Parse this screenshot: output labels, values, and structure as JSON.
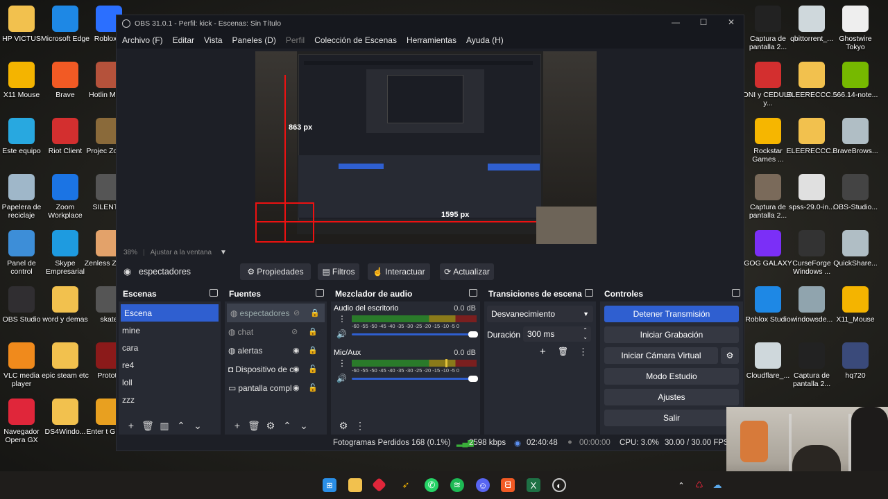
{
  "desktop_left": [
    {
      "label": "HP VICTUS",
      "icon": "folder-icon",
      "color": "#f2c14e"
    },
    {
      "label": "Microsoft Edge",
      "icon": "edge-icon",
      "color": "#1e88e5"
    },
    {
      "label": "Roblox P",
      "icon": "roblox-icon",
      "color": "#2b6fff"
    },
    {
      "label": "X11 Mouse",
      "icon": "x11-mouse-icon",
      "color": "#f4b400"
    },
    {
      "label": "Brave",
      "icon": "brave-icon",
      "color": "#f25a24"
    },
    {
      "label": "Hotlin Miami",
      "icon": "hotline-miami-icon",
      "color": "#b5523b"
    },
    {
      "label": "Este equipo",
      "icon": "computer-icon",
      "color": "#28a8e0"
    },
    {
      "label": "Riot Client",
      "icon": "riot-icon",
      "color": "#d32f2f"
    },
    {
      "label": "Projec Zombo",
      "icon": "project-zomboid-icon",
      "color": "#8a6a3a"
    },
    {
      "label": "Papelera de reciclaje",
      "icon": "recycle-bin-icon",
      "color": "#9fb7c9"
    },
    {
      "label": "Zoom Workplace",
      "icon": "zoom-icon",
      "color": "#1b74e4"
    },
    {
      "label": "SILENT H",
      "icon": "silent-hill-icon",
      "color": "#555"
    },
    {
      "label": "Panel de control",
      "icon": "control-panel-icon",
      "color": "#3d8ed8"
    },
    {
      "label": "Skype Empresarial",
      "icon": "skype-icon",
      "color": "#1e9be0"
    },
    {
      "label": "Zenless Z Zero",
      "icon": "zenless-icon",
      "color": "#e3a26a"
    },
    {
      "label": "OBS Studio",
      "icon": "obs-icon",
      "color": "#302e31"
    },
    {
      "label": "word y demas",
      "icon": "folder-icon",
      "color": "#f2c14e"
    },
    {
      "label": "skate",
      "icon": "skate-icon",
      "color": "#555"
    },
    {
      "label": "VLC media player",
      "icon": "vlc-icon",
      "color": "#f08a1c"
    },
    {
      "label": "epic steam etc",
      "icon": "folder-icon",
      "color": "#f2c14e"
    },
    {
      "label": "Prototy",
      "icon": "prototype-icon",
      "color": "#8b1a1a"
    },
    {
      "label": "Navegador Opera GX",
      "icon": "opera-gx-icon",
      "color": "#e0263a"
    },
    {
      "label": "DS4Windo...",
      "icon": "folder-icon",
      "color": "#f2c14e"
    },
    {
      "label": "Enter t Gunge",
      "icon": "gungeon-icon",
      "color": "#e8a020"
    }
  ],
  "desktop_right": [
    {
      "label": "Captura de pantalla 2...",
      "icon": "screenshot-icon",
      "color": "#222"
    },
    {
      "label": "qbittorrent_...",
      "icon": "qbittorrent-icon",
      "color": "#cfd8dc"
    },
    {
      "label": "Ghostwire Tokyo",
      "icon": "file-icon",
      "color": "#eeeeee"
    },
    {
      "label": "DNI y CEDULA y...",
      "icon": "pdf-icon",
      "color": "#d32f2f"
    },
    {
      "label": "ELEERECCC...",
      "icon": "zip-folder-icon",
      "color": "#f2c14e"
    },
    {
      "label": "566.14-note...",
      "icon": "nvidia-icon",
      "color": "#76b900"
    },
    {
      "label": "Rockstar Games ...",
      "icon": "rockstar-icon",
      "color": "#f6b600"
    },
    {
      "label": "ELEERECCC...",
      "icon": "folder-icon",
      "color": "#f2c14e"
    },
    {
      "label": "BraveBrows...",
      "icon": "installer-icon",
      "color": "#b0bec5"
    },
    {
      "label": "Captura de pantalla 2...",
      "icon": "screenshot-icon",
      "color": "#7a6a5a"
    },
    {
      "label": "spss-29.0-in...",
      "icon": "download-icon",
      "color": "#e0e0e0"
    },
    {
      "label": "OBS-Studio...",
      "icon": "obs-installer-icon",
      "color": "#444"
    },
    {
      "label": "GOG GALAXY",
      "icon": "gog-icon",
      "color": "#7b2ff7"
    },
    {
      "label": "CurseForge Windows ...",
      "icon": "curseforge-icon",
      "color": "#333"
    },
    {
      "label": "QuickShare...",
      "icon": "installer-icon",
      "color": "#b0bec5"
    },
    {
      "label": "Roblox Studio",
      "icon": "roblox-studio-icon",
      "color": "#1e88e5"
    },
    {
      "label": "windowsde...",
      "icon": "windows-installer-icon",
      "color": "#90a4ae"
    },
    {
      "label": "X11_Mouse",
      "icon": "x11-mouse-icon",
      "color": "#f4b400"
    },
    {
      "label": "Cloudflare_...",
      "icon": "cloudflare-icon",
      "color": "#cfd8dc"
    },
    {
      "label": "Captura de pantalla 2...",
      "icon": "screenshot-icon",
      "color": "#222"
    },
    {
      "label": "hq720",
      "icon": "image-icon",
      "color": "#3a4a7a"
    }
  ],
  "obs": {
    "title": "OBS 31.0.1 - Perfil: kick - Escenas: Sin Título",
    "menu": [
      "Archivo (F)",
      "Editar",
      "Vista",
      "Paneles (D)",
      "Perfil",
      "Colección de Escenas",
      "Herramientas",
      "Ayuda (H)"
    ],
    "preview": {
      "zoom": "38%",
      "fit": "Ajustar a la ventana",
      "measure_h": "863 px",
      "measure_w": "1595 px"
    },
    "source_toolbar": {
      "selected_source": "espectadores",
      "properties": "Propiedades",
      "filters": "Filtros",
      "interact": "Interactuar",
      "refresh": "Actualizar"
    },
    "scenes": {
      "title": "Escenas",
      "items": [
        "Escena",
        "mine",
        "cara",
        "re4",
        "loll",
        "zzz"
      ],
      "selected": "Escena"
    },
    "sources": {
      "title": "Fuentes",
      "items": [
        {
          "name": "espectadores",
          "type": "browser",
          "visible": "hidden",
          "locked": true
        },
        {
          "name": "chat",
          "type": "browser",
          "visible": "hidden",
          "locked": true
        },
        {
          "name": "alertas",
          "type": "browser",
          "visible": "shown",
          "locked": true
        },
        {
          "name": "Dispositivo de c",
          "type": "camera",
          "visible": "shown",
          "locked": false
        },
        {
          "name": "pantalla compl",
          "type": "display",
          "visible": "shown",
          "locked": false
        }
      ]
    },
    "mixer": {
      "title": "Mezclador de audio",
      "channels": [
        {
          "name": "Audio del escritorio",
          "db": "0.0 dB",
          "level": 0.0
        },
        {
          "name": "Mic/Aux",
          "db": "0.0 dB",
          "level": 0.7
        }
      ],
      "scale": "-60 -55 -50 -45 -40 -35 -30 -25 -20 -15 -10 -5 0"
    },
    "transitions": {
      "title": "Transiciones de escena",
      "selected": "Desvanecimiento",
      "duration_label": "Duración",
      "duration_value": "300 ms"
    },
    "controls": {
      "title": "Controles",
      "stop_stream": "Detener Transmisión",
      "start_record": "Iniciar Grabación",
      "virtual_cam": "Iniciar Cámara Virtual",
      "studio_mode": "Modo Estudio",
      "settings": "Ajustes",
      "exit": "Salir"
    },
    "status": {
      "dropped": "Fotogramas Perdidos 168 (0.1%)",
      "bitrate": "2598 kbps",
      "stream_time": "02:40:48",
      "record_time": "00:00:00",
      "cpu": "CPU: 3.0%",
      "fps": "30.00 / 30.00 FPS"
    }
  },
  "taskbar": {
    "apps": [
      "windows-start-icon",
      "file-explorer-icon",
      "diamond-app-icon",
      "x11-mouse-icon",
      "whatsapp-icon",
      "spotify-icon",
      "discord-icon",
      "brave-icon",
      "excel-icon",
      "obs-icon"
    ]
  }
}
